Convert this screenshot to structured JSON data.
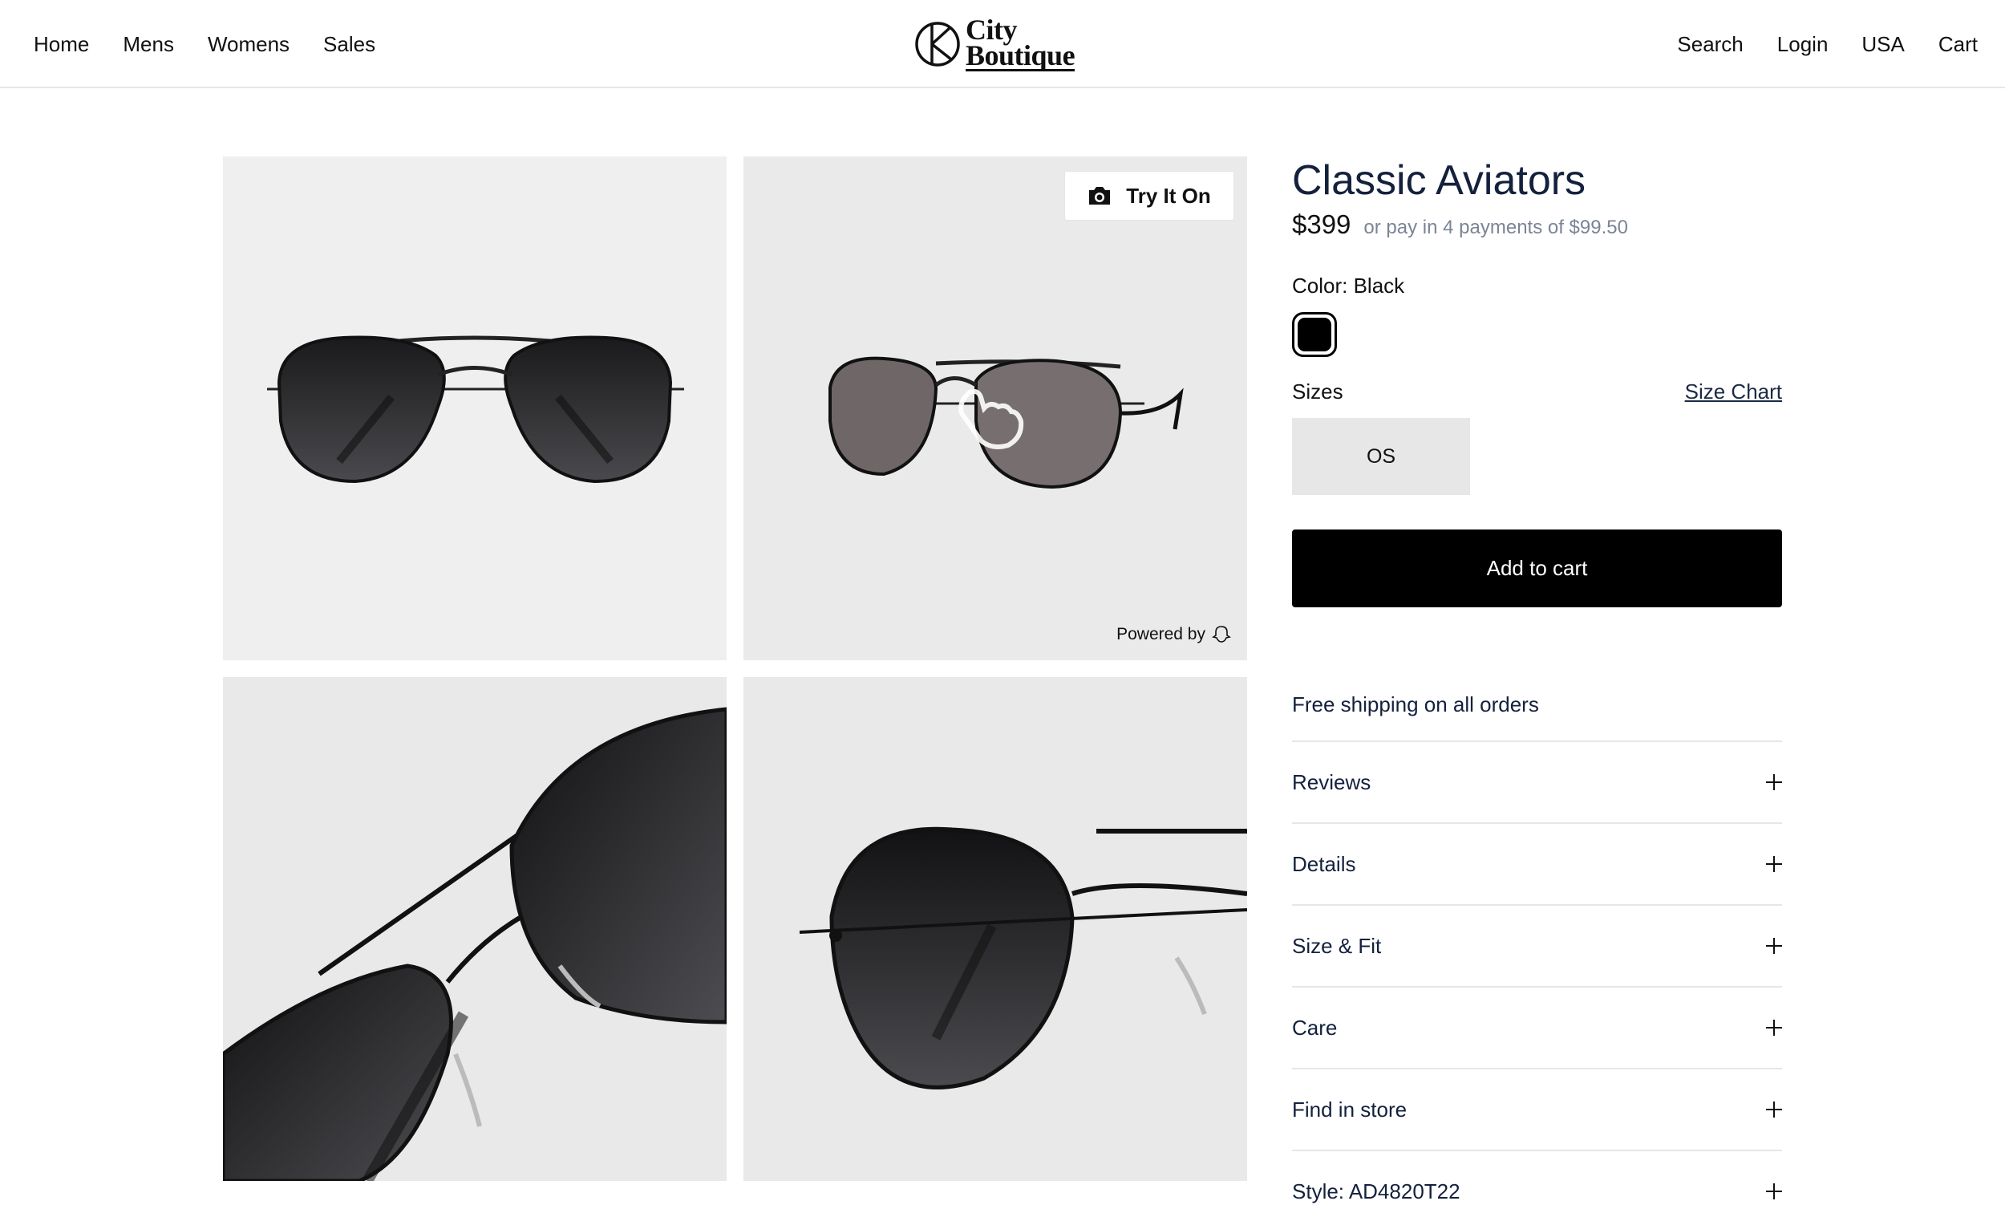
{
  "header": {
    "nav_left": [
      "Home",
      "Mens",
      "Womens",
      "Sales"
    ],
    "logo": {
      "line1": "City",
      "line2": "Boutique"
    },
    "nav_right": [
      "Search",
      "Login",
      "USA",
      "Cart"
    ]
  },
  "gallery": {
    "try_on_label": "Try It On",
    "powered_by": "Powered by",
    "icons": {
      "try_on": "camera-icon",
      "powered_by": "ghost-icon",
      "hint": "hand-pointer-icon"
    }
  },
  "product": {
    "title": "Classic Aviators",
    "price": "$399",
    "installments": "or pay in 4 payments of $99.50",
    "color_label": "Color: Black",
    "swatch_color": "#000000",
    "sizes_label": "Sizes",
    "size_chart_label": "Size Chart",
    "size_option": "OS",
    "add_to_cart": "Add to cart",
    "shipping": "Free shipping on all orders",
    "accordion": [
      "Reviews",
      "Details",
      "Size & Fit",
      "Care",
      "Find in store",
      "Style: AD4820T22"
    ]
  }
}
